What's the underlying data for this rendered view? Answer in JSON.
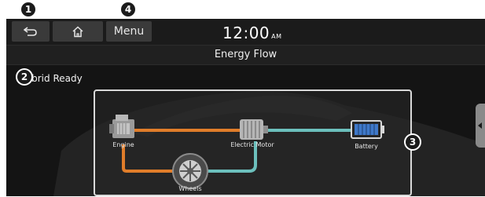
{
  "callouts": [
    "1",
    "2",
    "3",
    "4"
  ],
  "header": {
    "menu_label": "Menu",
    "time": "12:00",
    "ampm": "AM"
  },
  "title": "Energy Flow",
  "status": "Hybrid Ready",
  "flow": {
    "engine_label": "Engine",
    "motor_label": "Electric Motor",
    "battery_label": "Battery",
    "wheels_label": "Wheels"
  },
  "colors": {
    "engine_flow": "#e07d2a",
    "battery_flow": "#6cc0bd"
  }
}
